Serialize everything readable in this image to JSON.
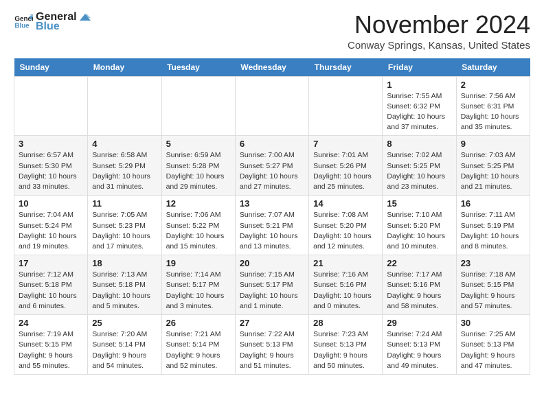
{
  "logo": {
    "line1": "General",
    "line2": "Blue"
  },
  "title": "November 2024",
  "subtitle": "Conway Springs, Kansas, United States",
  "days_of_week": [
    "Sunday",
    "Monday",
    "Tuesday",
    "Wednesday",
    "Thursday",
    "Friday",
    "Saturday"
  ],
  "weeks": [
    [
      {
        "day": "",
        "info": ""
      },
      {
        "day": "",
        "info": ""
      },
      {
        "day": "",
        "info": ""
      },
      {
        "day": "",
        "info": ""
      },
      {
        "day": "",
        "info": ""
      },
      {
        "day": "1",
        "info": "Sunrise: 7:55 AM\nSunset: 6:32 PM\nDaylight: 10 hours and 37 minutes."
      },
      {
        "day": "2",
        "info": "Sunrise: 7:56 AM\nSunset: 6:31 PM\nDaylight: 10 hours and 35 minutes."
      }
    ],
    [
      {
        "day": "3",
        "info": "Sunrise: 6:57 AM\nSunset: 5:30 PM\nDaylight: 10 hours and 33 minutes."
      },
      {
        "day": "4",
        "info": "Sunrise: 6:58 AM\nSunset: 5:29 PM\nDaylight: 10 hours and 31 minutes."
      },
      {
        "day": "5",
        "info": "Sunrise: 6:59 AM\nSunset: 5:28 PM\nDaylight: 10 hours and 29 minutes."
      },
      {
        "day": "6",
        "info": "Sunrise: 7:00 AM\nSunset: 5:27 PM\nDaylight: 10 hours and 27 minutes."
      },
      {
        "day": "7",
        "info": "Sunrise: 7:01 AM\nSunset: 5:26 PM\nDaylight: 10 hours and 25 minutes."
      },
      {
        "day": "8",
        "info": "Sunrise: 7:02 AM\nSunset: 5:25 PM\nDaylight: 10 hours and 23 minutes."
      },
      {
        "day": "9",
        "info": "Sunrise: 7:03 AM\nSunset: 5:25 PM\nDaylight: 10 hours and 21 minutes."
      }
    ],
    [
      {
        "day": "10",
        "info": "Sunrise: 7:04 AM\nSunset: 5:24 PM\nDaylight: 10 hours and 19 minutes."
      },
      {
        "day": "11",
        "info": "Sunrise: 7:05 AM\nSunset: 5:23 PM\nDaylight: 10 hours and 17 minutes."
      },
      {
        "day": "12",
        "info": "Sunrise: 7:06 AM\nSunset: 5:22 PM\nDaylight: 10 hours and 15 minutes."
      },
      {
        "day": "13",
        "info": "Sunrise: 7:07 AM\nSunset: 5:21 PM\nDaylight: 10 hours and 13 minutes."
      },
      {
        "day": "14",
        "info": "Sunrise: 7:08 AM\nSunset: 5:20 PM\nDaylight: 10 hours and 12 minutes."
      },
      {
        "day": "15",
        "info": "Sunrise: 7:10 AM\nSunset: 5:20 PM\nDaylight: 10 hours and 10 minutes."
      },
      {
        "day": "16",
        "info": "Sunrise: 7:11 AM\nSunset: 5:19 PM\nDaylight: 10 hours and 8 minutes."
      }
    ],
    [
      {
        "day": "17",
        "info": "Sunrise: 7:12 AM\nSunset: 5:18 PM\nDaylight: 10 hours and 6 minutes."
      },
      {
        "day": "18",
        "info": "Sunrise: 7:13 AM\nSunset: 5:18 PM\nDaylight: 10 hours and 5 minutes."
      },
      {
        "day": "19",
        "info": "Sunrise: 7:14 AM\nSunset: 5:17 PM\nDaylight: 10 hours and 3 minutes."
      },
      {
        "day": "20",
        "info": "Sunrise: 7:15 AM\nSunset: 5:17 PM\nDaylight: 10 hours and 1 minute."
      },
      {
        "day": "21",
        "info": "Sunrise: 7:16 AM\nSunset: 5:16 PM\nDaylight: 10 hours and 0 minutes."
      },
      {
        "day": "22",
        "info": "Sunrise: 7:17 AM\nSunset: 5:16 PM\nDaylight: 9 hours and 58 minutes."
      },
      {
        "day": "23",
        "info": "Sunrise: 7:18 AM\nSunset: 5:15 PM\nDaylight: 9 hours and 57 minutes."
      }
    ],
    [
      {
        "day": "24",
        "info": "Sunrise: 7:19 AM\nSunset: 5:15 PM\nDaylight: 9 hours and 55 minutes."
      },
      {
        "day": "25",
        "info": "Sunrise: 7:20 AM\nSunset: 5:14 PM\nDaylight: 9 hours and 54 minutes."
      },
      {
        "day": "26",
        "info": "Sunrise: 7:21 AM\nSunset: 5:14 PM\nDaylight: 9 hours and 52 minutes."
      },
      {
        "day": "27",
        "info": "Sunrise: 7:22 AM\nSunset: 5:13 PM\nDaylight: 9 hours and 51 minutes."
      },
      {
        "day": "28",
        "info": "Sunrise: 7:23 AM\nSunset: 5:13 PM\nDaylight: 9 hours and 50 minutes."
      },
      {
        "day": "29",
        "info": "Sunrise: 7:24 AM\nSunset: 5:13 PM\nDaylight: 9 hours and 49 minutes."
      },
      {
        "day": "30",
        "info": "Sunrise: 7:25 AM\nSunset: 5:13 PM\nDaylight: 9 hours and 47 minutes."
      }
    ]
  ]
}
